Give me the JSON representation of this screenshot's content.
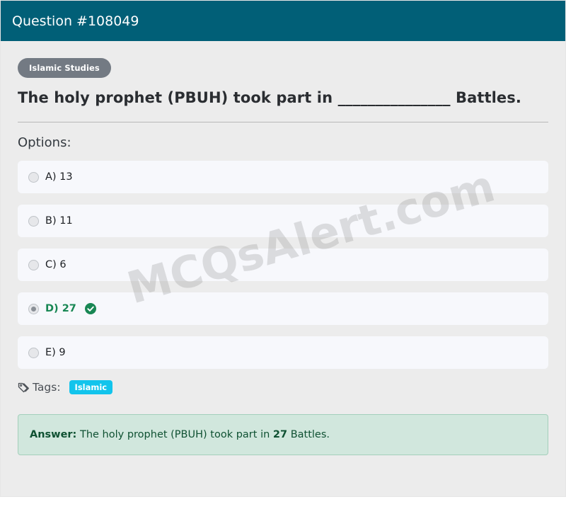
{
  "header": {
    "title": "Question #108049"
  },
  "question": {
    "category": "Islamic Studies",
    "title": "The holy prophet (PBUH) took part in _______________ Battles.",
    "options_label": "Options:",
    "options": [
      {
        "label": "A) 13"
      },
      {
        "label": "B) 11"
      },
      {
        "label": "C) 6"
      },
      {
        "label": "D) 27"
      },
      {
        "label": "E) 9"
      }
    ],
    "selected_option": "D) 27"
  },
  "tags": {
    "label": "Tags:",
    "items": [
      "Islamic"
    ]
  },
  "answer": {
    "prefix": "Answer:",
    "text_before": " The holy prophet (PBUH) took part in ",
    "value": "27",
    "text_after": " Battles."
  },
  "watermark": {
    "text": "MCQsAlert.com"
  },
  "colors": {
    "header": "#015f77",
    "correct": "#198754",
    "tag": "#12c4ec",
    "answer_bg": "#d1e7dd"
  },
  "icons": {
    "tag": "tags-icon",
    "correct": "check-circle-icon"
  }
}
